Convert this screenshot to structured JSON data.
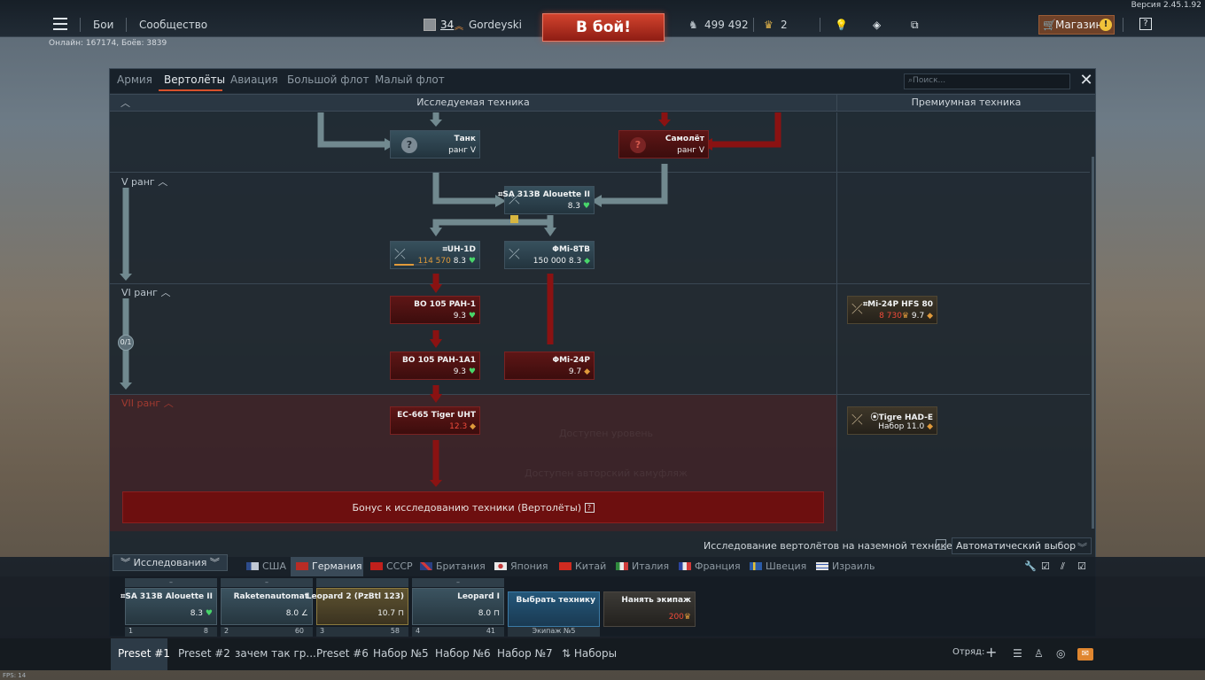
{
  "version": "Версия 2.45.1.92",
  "fps": "FPS: 14",
  "online": "Онлайн: 167174, Боёв: 3839",
  "top": {
    "menu_icon": "hamburger-icon",
    "battles": "Бои",
    "community": "Сообщество",
    "level": "34",
    "nickname": "Gordeyski",
    "fight": "В бой!",
    "silver": "499 492",
    "gold": "2",
    "shop": "Магазин",
    "shop_badge": "!",
    "help": "?"
  },
  "tabs": [
    "Армия",
    "Вертолёты",
    "Авиация",
    "Большой флот",
    "Малый флот"
  ],
  "search_placeholder": "Поиск...",
  "headers": {
    "research": "Исследуемая техника",
    "premium": "Премиумная техника"
  },
  "ranks": {
    "r5": "V ранг",
    "r6": "VI ранг",
    "r7": "VII ранг"
  },
  "progress_badge": "0/1",
  "cards": {
    "tank": {
      "name": "Танк",
      "sub": "ранг V"
    },
    "plane": {
      "name": "Самолёт",
      "sub": "ранг V"
    },
    "alouette": {
      "name": "SA 313B Alouette II",
      "br": "8.3"
    },
    "uh1d": {
      "name": "UH-1D",
      "rp": "114 570",
      "br": "8.3"
    },
    "mi8tb": {
      "name": "Mi-8TB",
      "rp": "150 000",
      "br": "8.3"
    },
    "bo105": {
      "name": "BO 105 PAH-1",
      "br": "9.3"
    },
    "bo105a1": {
      "name": "BO 105 PAH-1A1",
      "br": "9.3"
    },
    "mi24p": {
      "name": "Mi-24P",
      "br": "9.7"
    },
    "ec665": {
      "name": "EC-665 Tiger UHT",
      "br": "12.3"
    },
    "mi24hfs": {
      "name": "Mi-24P HFS 80",
      "cost": "8 730",
      "br": "9.7"
    },
    "tigre": {
      "name": "Tigre HAD-E",
      "sub": "Набор 11.0"
    }
  },
  "bonus": "Бонус к исследованию техники (Вертолёты)",
  "bonus_help": "?",
  "ghost_lines": [
    "Доступен уровень",
    "Доступен авторский камуфляж"
  ],
  "option": {
    "label": "Исследование вертолётов на наземной технике",
    "select": "Автоматический выбор"
  },
  "research_tab": "Исследования",
  "nations": [
    {
      "name": "США",
      "colors": [
        "#2d4c8c",
        "#c0c8d4"
      ]
    },
    {
      "name": "Германия",
      "colors": [
        "#b92c25",
        "#e6e6e6"
      ]
    },
    {
      "name": "СССР",
      "colors": [
        "#c0201c",
        "#c0201c"
      ]
    },
    {
      "name": "Британия",
      "colors": [
        "#2a3f82",
        "#d0383a"
      ]
    },
    {
      "name": "Япония",
      "colors": [
        "#c33a3a",
        "#e9e9e9"
      ]
    },
    {
      "name": "Китай",
      "colors": [
        "#d02b20",
        "#d02b20"
      ]
    },
    {
      "name": "Италия",
      "colors": [
        "#2f8a3d",
        "#d03b3b"
      ]
    },
    {
      "name": "Франция",
      "colors": [
        "#2b44a0",
        "#d23a3a"
      ]
    },
    {
      "name": "Швеция",
      "colors": [
        "#2a5ba8",
        "#e3c236"
      ]
    },
    {
      "name": "Израиль",
      "colors": [
        "#e6e6e6",
        "#3a5db0"
      ]
    }
  ],
  "crew": [
    {
      "name": "SA 313B Alouette II",
      "br": "8.3",
      "num": "1",
      "count": "8",
      "top": "–"
    },
    {
      "name": "Raketenautomat",
      "br": "8.0",
      "num": "2",
      "count": "60",
      "top": "–"
    },
    {
      "name": "Leopard 2 (PzBtl 123)",
      "br": "10.7",
      "num": "3",
      "count": "58",
      "top": ""
    },
    {
      "name": "Leopard I",
      "br": "8.0",
      "num": "4",
      "count": "41",
      "top": "–"
    }
  ],
  "choose": {
    "label": "Выбрать технику",
    "foot": "Экипаж №5"
  },
  "hire": {
    "label": "Нанять экипаж",
    "cost": "200"
  },
  "presets": [
    "Preset #1",
    "Preset #2",
    "зачем так гр...",
    "Preset #6",
    "Набор №5",
    "Набор №6",
    "Набор №7",
    "Наборы"
  ],
  "squad": "Отряд:"
}
